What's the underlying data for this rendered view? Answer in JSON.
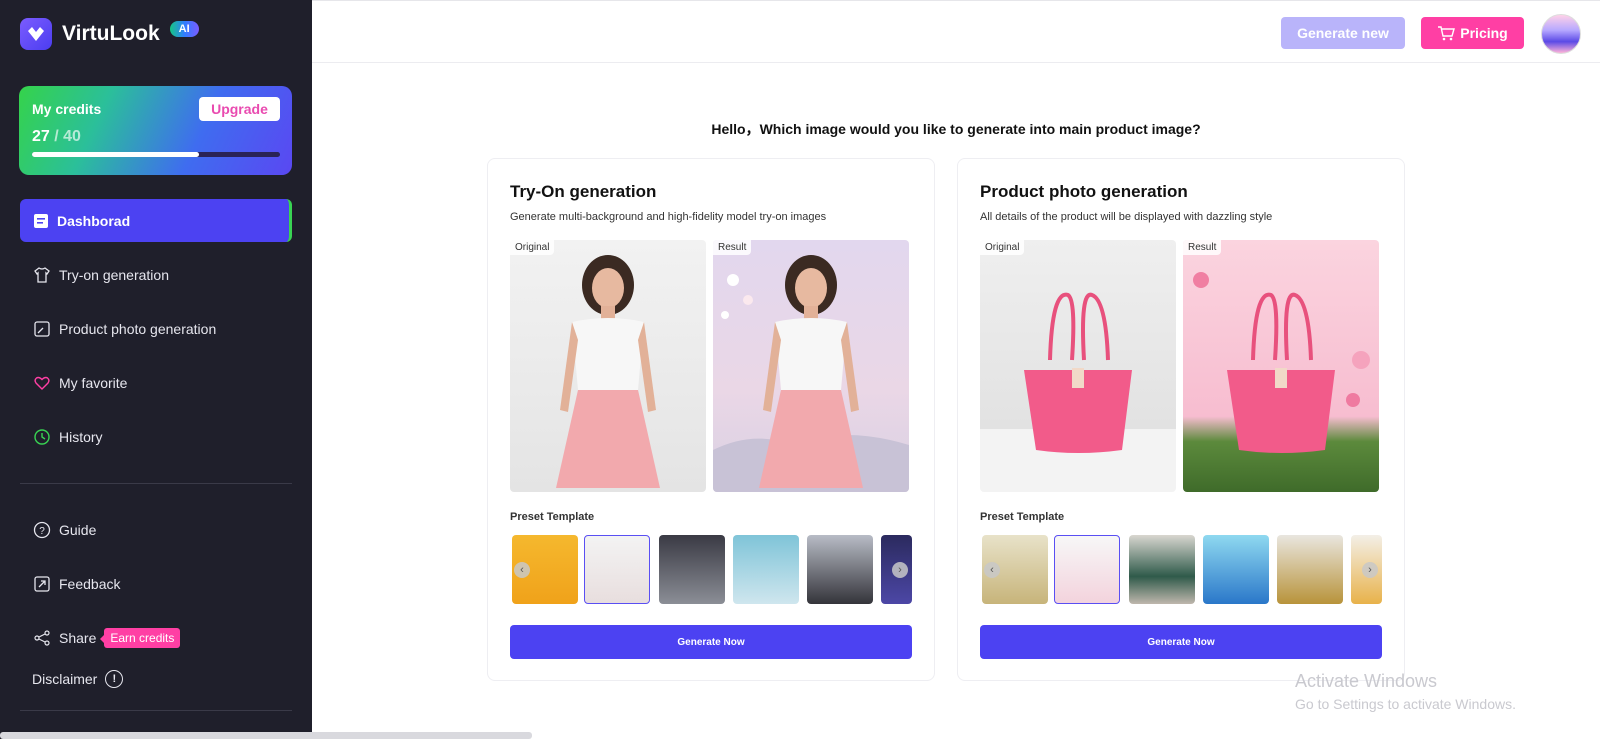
{
  "sidebar": {
    "brand": "VirtuLook",
    "ai_badge": "AI",
    "credits": {
      "title": "My credits",
      "upgrade": "Upgrade",
      "used": "27",
      "total": "/ 40",
      "fraction": 0.675
    },
    "nav": [
      {
        "label": "Dashborad"
      },
      {
        "label": "Try-on generation"
      },
      {
        "label": "Product photo generation"
      },
      {
        "label": "My favorite"
      },
      {
        "label": "History"
      },
      {
        "label": "Guide"
      },
      {
        "label": "Feedback"
      },
      {
        "label": "Share"
      }
    ],
    "earn_credits": "Earn credits",
    "disclaimer": "Disclaimer",
    "disclaimer_icon": "!"
  },
  "header": {
    "generate_new": "Generate new",
    "pricing": "Pricing"
  },
  "greeting": "Hello，Which image would you like to generate into main product image?",
  "cards": [
    {
      "title": "Try-On generation",
      "subtitle": "Generate multi-background and high-fidelity model try-on images",
      "original_label": "Original",
      "result_label": "Result",
      "preset_label": "Preset Template",
      "button": "Generate Now"
    },
    {
      "title": "Product photo generation",
      "subtitle": "All details of the product will be displayed with dazzling style",
      "original_label": "Original",
      "result_label": "Result",
      "preset_label": "Preset Template",
      "button": "Generate Now"
    }
  ],
  "watermark": {
    "line1": "Activate Windows",
    "line2": "Go to Settings to activate Windows."
  },
  "colors": {
    "accent": "#4c42f2",
    "pink": "#ff3fa4",
    "sidebar": "#1f1f2b"
  }
}
